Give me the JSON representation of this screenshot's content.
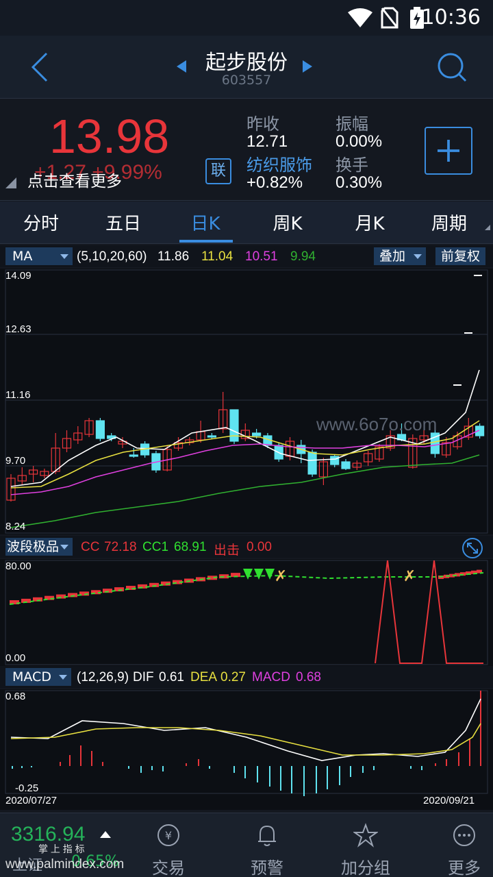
{
  "status_bar": {
    "time": "10:36"
  },
  "header": {
    "stock_name": "起步股份",
    "stock_code": "603557"
  },
  "quote": {
    "price": "13.98",
    "change": "+1.27 +9.99%",
    "more_tip": "点击查看更多",
    "lian_label": "联",
    "prev_close_label": "昨收",
    "prev_close": "12.71",
    "amplitude_label": "振幅",
    "amplitude": "0.00%",
    "industry": "纺织服饰",
    "industry_change": "+0.82%",
    "turnover_label": "换手",
    "turnover": "0.30%"
  },
  "tabs": [
    {
      "label": "分时"
    },
    {
      "label": "五日"
    },
    {
      "label": "日K"
    },
    {
      "label": "周K"
    },
    {
      "label": "月K"
    },
    {
      "label": "周期"
    }
  ],
  "ma_bar": {
    "selector": "MA",
    "params": "(5,10,20,60)",
    "ma5": "11.86",
    "ma10": "11.04",
    "ma20": "10.51",
    "ma60": "9.94",
    "overlay_btn": "叠加",
    "adjust_btn": "前复权"
  },
  "kline_axis": {
    "y_top": "14.09",
    "y_2": "12.63",
    "y_3": "11.16",
    "y_4": "9.70",
    "y_bottom": "8.24"
  },
  "wave_bar": {
    "selector": "波段极品",
    "cc_label": "CC",
    "cc": "72.18",
    "cc1_label": "CC1",
    "cc1": "68.91",
    "exit_label": "出击",
    "exit": "0.00"
  },
  "wave_axis": {
    "y_top": "80.00",
    "y_bottom": "0.00"
  },
  "macd_bar": {
    "selector": "MACD",
    "params": "(12,26,9)",
    "dif_label": "DIF",
    "dif": "0.61",
    "dea_label": "DEA",
    "dea": "0.27",
    "macd_label": "MACD",
    "macd": "0.68"
  },
  "macd_axis": {
    "y_top": "0.68",
    "y_bottom": "-0.25",
    "date_start": "2020/07/27",
    "date_end": "2020/09/21"
  },
  "chart_watermark": "www.6o7o.com",
  "bottom_nav": {
    "index_value": "3316.94",
    "index_name": "上证",
    "index_change": "0.65%",
    "items": [
      {
        "label": "交易"
      },
      {
        "label": "预警"
      },
      {
        "label": "加分组"
      },
      {
        "label": "更多"
      }
    ]
  },
  "watermark": {
    "line1": "掌 上 指 标",
    "line2": "www.palmindex.com"
  },
  "colors": {
    "up": "#e8353a",
    "down": "#5fe3f0",
    "ma5": "#ffffff",
    "ma10": "#e8e040",
    "ma20": "#e040e0",
    "ma60": "#30b030",
    "accent": "#3a8de0"
  }
}
